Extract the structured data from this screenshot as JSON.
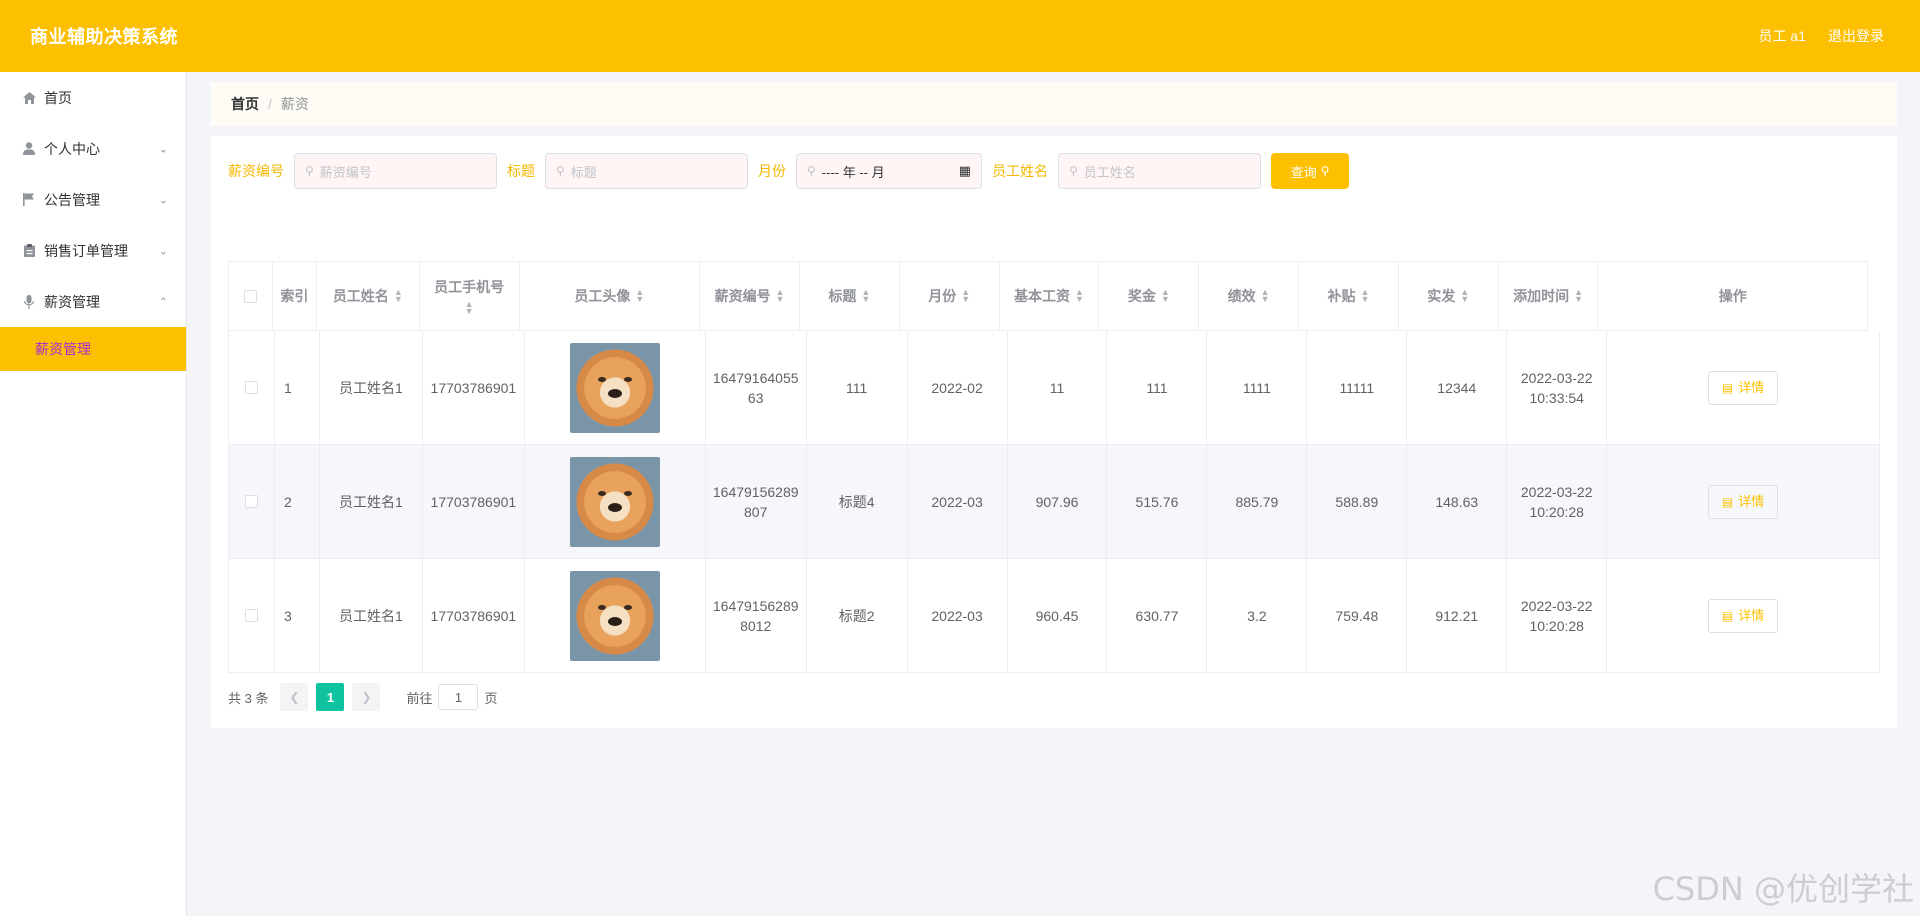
{
  "header": {
    "title": "商业辅助决策系统",
    "user": "员工 a1",
    "logout": "退出登录"
  },
  "sidebar": {
    "items": [
      {
        "label": "首页",
        "icon": "home-icon",
        "chev": ""
      },
      {
        "label": "个人中心",
        "icon": "user-icon",
        "chev": "⌄"
      },
      {
        "label": "公告管理",
        "icon": "flag-icon",
        "chev": "⌄"
      },
      {
        "label": "销售订单管理",
        "icon": "clipboard-icon",
        "chev": "⌄"
      },
      {
        "label": "薪资管理",
        "icon": "mic-icon",
        "chev": "⌃"
      }
    ],
    "sub_active": "薪资管理"
  },
  "breadcrumb": {
    "home": "首页",
    "sep": "/",
    "current": "薪资"
  },
  "filters": {
    "f1_label": "薪资编号",
    "f1_placeholder": "薪资编号",
    "f2_label": "标题",
    "f2_placeholder": "标题",
    "f3_label": "月份",
    "f3_value": "---- 年 -- 月",
    "f4_label": "员工姓名",
    "f4_placeholder": "员工姓名",
    "query": "查询"
  },
  "table": {
    "headers": {
      "index": "索引",
      "name": "员工姓名",
      "phone": "员工手机号",
      "avatar": "员工头像",
      "salary_no": "薪资编号",
      "title": "标题",
      "month": "月份",
      "base": "基本工资",
      "bonus": "奖金",
      "perf": "绩效",
      "subsidy": "补贴",
      "actual": "实发",
      "added": "添加时间",
      "ops": "操作"
    },
    "rows": [
      {
        "index": "1",
        "name": "员工姓名1",
        "phone": "17703786901",
        "salary_no_1": "16479164055",
        "salary_no_2": "63",
        "title": "111",
        "month": "2022-02",
        "base": "11",
        "bonus": "111",
        "perf": "1111",
        "subsidy": "11111",
        "actual": "12344",
        "date": "2022-03-22",
        "time": "10:33:54",
        "detail": "详情"
      },
      {
        "index": "2",
        "name": "员工姓名1",
        "phone": "17703786901",
        "salary_no_1": "16479156289",
        "salary_no_2": "807",
        "title": "标题4",
        "month": "2022-03",
        "base": "907.96",
        "bonus": "515.76",
        "perf": "885.79",
        "subsidy": "588.89",
        "actual": "148.63",
        "date": "2022-03-22",
        "time": "10:20:28",
        "detail": "详情"
      },
      {
        "index": "3",
        "name": "员工姓名1",
        "phone": "17703786901",
        "salary_no_1": "16479156289",
        "salary_no_2": "8012",
        "title": "标题2",
        "month": "2022-03",
        "base": "960.45",
        "bonus": "630.77",
        "perf": "3.2",
        "subsidy": "759.48",
        "actual": "912.21",
        "date": "2022-03-22",
        "time": "10:20:28",
        "detail": "详情"
      }
    ]
  },
  "pagination": {
    "total": "共 3 条",
    "page": "1",
    "goto": "前往",
    "goto_value": "1",
    "unit": "页"
  },
  "watermark": "CSDN @优创学社",
  "colors": {
    "header": "#fdc001",
    "accent_text": "#f5b800",
    "active_page": "#0fc3a1",
    "sub_active_text": "#a62bd6"
  }
}
